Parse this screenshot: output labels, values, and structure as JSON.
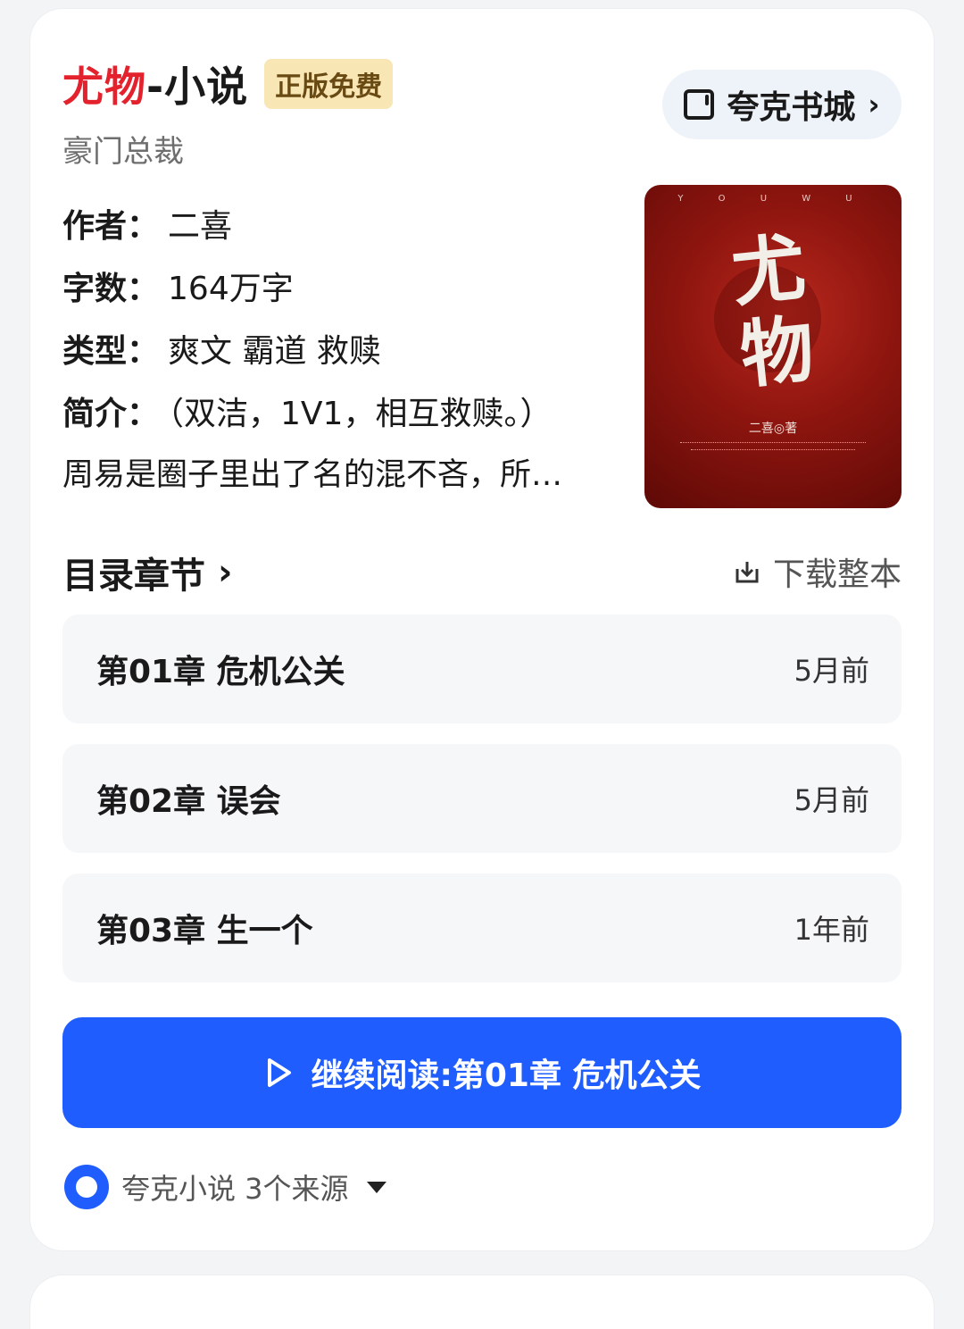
{
  "book": {
    "title_main": "尤物",
    "title_suffix": "-小说",
    "badge": "正版免费",
    "genre": "豪门总裁",
    "store_label": "夸克书城",
    "author_key": "作者：",
    "author": "二喜",
    "words_key": "字数：",
    "words": "164万字",
    "type_key": "类型：",
    "type": "爽文 霸道 救赎",
    "intro_key": "简介：",
    "intro_line1": "（双洁，1V1，相互救赎。）",
    "intro_line2": "周易是圈子里出了名的混不吝，所…"
  },
  "cover": {
    "top_text": "Y O U W U",
    "title": "尤物",
    "author": "二喜◎著"
  },
  "toc": {
    "heading": "目录章节",
    "download_label": "下载整本",
    "chapters": [
      {
        "title": "第01章 危机公关",
        "time": "5月前"
      },
      {
        "title": "第02章 误会",
        "time": "5月前"
      },
      {
        "title": "第03章 生一个",
        "time": "1年前"
      }
    ]
  },
  "continue": {
    "label": "继续阅读:第01章 危机公关"
  },
  "source": {
    "label": "夸克小说 3个来源"
  },
  "colors": {
    "accent_blue": "#1f5dff",
    "title_red": "#e3222d",
    "badge_bg": "#f8e6b5"
  }
}
